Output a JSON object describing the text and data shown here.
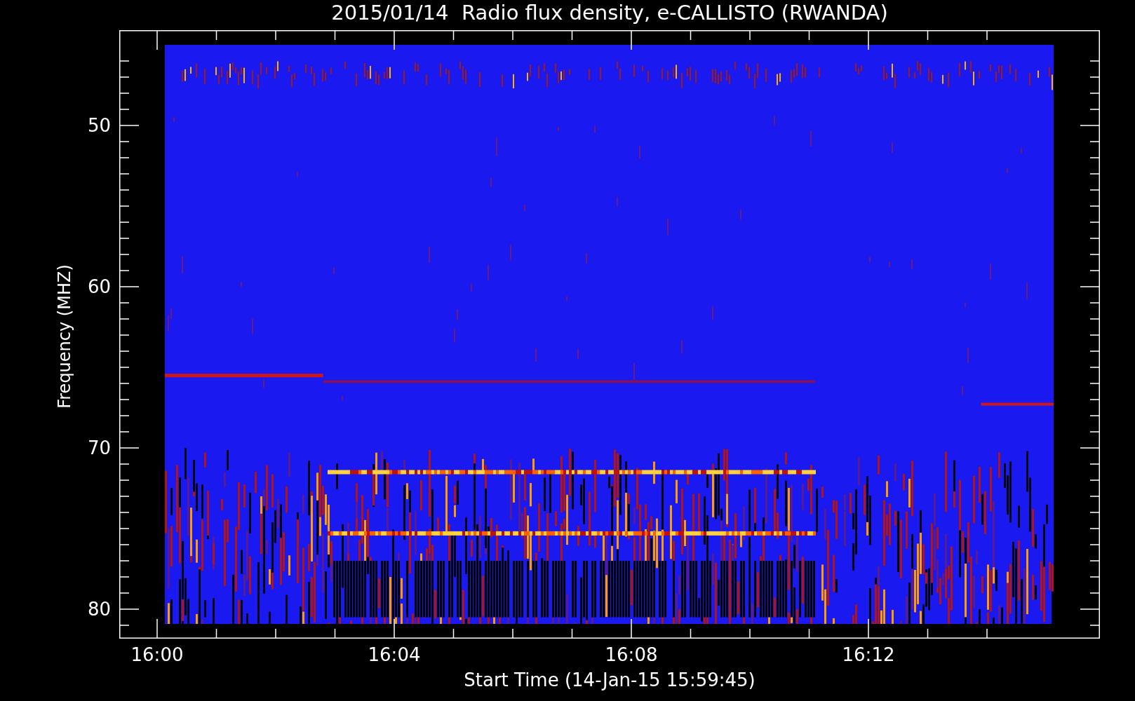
{
  "title": "2015/01/14  Radio flux density, e-CALLISTO (RWANDA)",
  "y_axis": {
    "label": "Frequency (MHZ)",
    "ticks": [
      "50",
      "60",
      "70",
      "80"
    ]
  },
  "x_axis": {
    "label": "Start Time (14-Jan-15 15:59:45)",
    "ticks": [
      "16:00",
      "16:04",
      "16:08",
      "16:12"
    ]
  }
}
